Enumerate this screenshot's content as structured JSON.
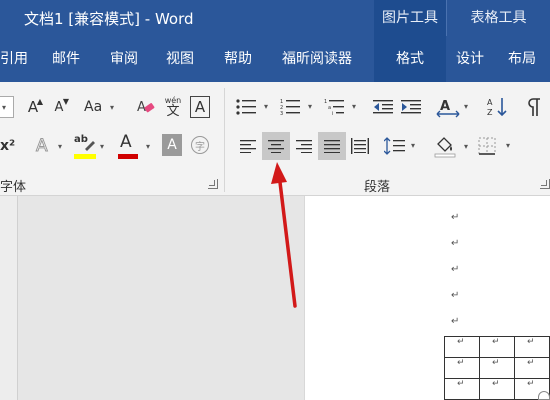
{
  "window": {
    "title": "文档1 [兼容模式]  -  Word",
    "context_groups": [
      "图片工具",
      "表格工具"
    ]
  },
  "tabs": [
    "引用",
    "邮件",
    "审阅",
    "视图",
    "帮助",
    "福昕阅读器",
    "格式",
    "设计",
    "布局"
  ],
  "ribbon": {
    "font_group_label": "字体",
    "paragraph_group_label": "段落",
    "grow_font_glyph": "A",
    "shrink_font_glyph": "A",
    "change_case_glyph": "Aa",
    "phonetic_top": "wén",
    "phonetic_bottom": "文",
    "char_border_glyph": "A",
    "superscript_glyph": "x²",
    "text_effects_glyph": "A",
    "highlight_glyph": "ab",
    "font_color_glyph": "A",
    "char_shading_glyph": "A",
    "enclose_char_glyph": "字"
  },
  "colors": {
    "title_bar": "#2b579a",
    "highlight_bar": "#ffff00",
    "font_color_bar": "#d00000",
    "annotation_arrow": "#d21919"
  },
  "document": {
    "paragraph_mark": "↵"
  }
}
